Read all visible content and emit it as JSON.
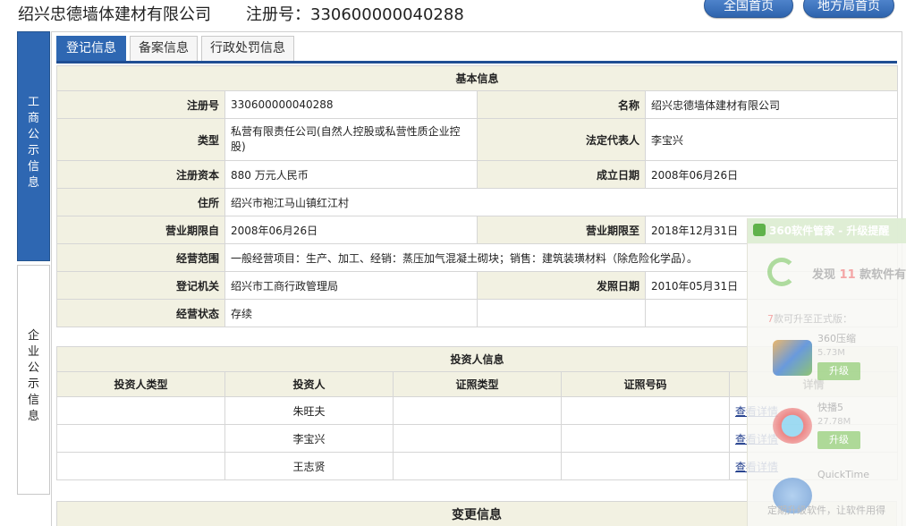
{
  "header": {
    "company_name": "绍兴忠德墙体建材有限公司",
    "registration": "注册号：330600000040288",
    "national_home_button": "全国首页",
    "local_home_button": "地方局首页"
  },
  "side_nav": [
    {
      "label_chars": [
        "工",
        "商",
        "公",
        "示",
        "信",
        "息"
      ],
      "active": true
    },
    {
      "label_chars": [
        "企",
        "业",
        "公",
        "示",
        "信",
        "息"
      ],
      "active": false
    }
  ],
  "tabs": [
    "登记信息",
    "备案信息",
    "行政处罚信息"
  ],
  "basic_info": {
    "title": "基本信息",
    "reg_no_label": "注册号",
    "reg_no": "330600000040288",
    "name_label": "名称",
    "name": "绍兴忠德墙体建材有限公司",
    "type_label": "类型",
    "type": "私营有限责任公司(自然人控股或私营性质企业控股)",
    "legal_rep_label": "法定代表人",
    "legal_rep": "李宝兴",
    "capital_label": "注册资本",
    "capital": "880 万元人民币",
    "founded_label": "成立日期",
    "founded": "2008年06月26日",
    "address_label": "住所",
    "address": "绍兴市袍江马山镇红江村",
    "term_from_label": "营业期限自",
    "term_from": "2008年06月26日",
    "term_to_label": "营业期限至",
    "term_to": "2018年12月31日",
    "scope_label": "经营范围",
    "scope": "一般经营项目：生产、加工、经销：蒸压加气混凝土砌块；销售：建筑装璜材料（除危险化学品）。",
    "authority_label": "登记机关",
    "authority": "绍兴市工商行政管理局",
    "issue_date_label": "发照日期",
    "issue_date": "2010年05月31日",
    "status_label": "经营状态",
    "status": "存续"
  },
  "investors": {
    "title": "投资人信息",
    "columns": [
      "投资人类型",
      "投资人",
      "证照类型",
      "证照号码",
      "详情"
    ],
    "rows": [
      {
        "type": "",
        "name": "朱旺夫",
        "cert_type": "",
        "cert_no": "",
        "detail": "查看详情"
      },
      {
        "type": "",
        "name": "李宝兴",
        "cert_type": "",
        "cert_no": "",
        "detail": "查看详情"
      },
      {
        "type": "",
        "name": "王志贤",
        "cert_type": "",
        "cert_no": "",
        "detail": "查看详情"
      }
    ]
  },
  "change_info_title": "变更信息",
  "popup": {
    "title": "360软件管家 - 升级提醒",
    "found_prefix": "发现",
    "found_count": "11",
    "found_suffix": "款软件有",
    "upgrade_count": "7",
    "upgrade_text": "款可升至正式版：",
    "apps": [
      {
        "name": "360压缩",
        "size": "5.73M",
        "button": "升级"
      },
      {
        "name": "快播5",
        "size": "27.78M",
        "button": "升级"
      },
      {
        "name": "QuickTime",
        "size": "",
        "button": ""
      }
    ],
    "footer": "定期升级软件，让软件用得"
  },
  "colors": {
    "accent_blue": "#2e67b2",
    "label_bg": "#f2f1e2",
    "tab_line": "#1f4e93"
  }
}
